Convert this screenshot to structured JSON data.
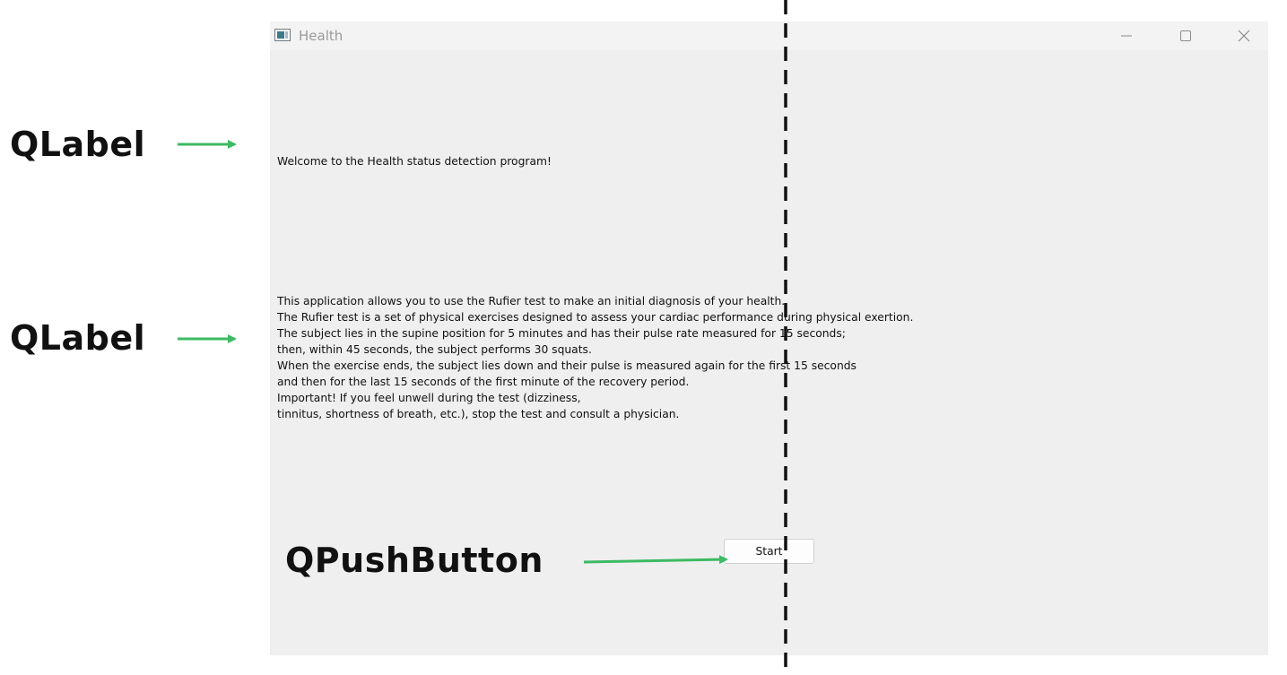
{
  "window": {
    "title": "Health",
    "buttons": {
      "minimize": "minimize-icon",
      "maximize": "maximize-icon",
      "close": "close-icon"
    }
  },
  "content": {
    "welcome_label": "Welcome to the Health status detection program!",
    "info_lines": [
      "This application allows you to use the Rufier test to make an initial diagnosis of your health.",
      "The Rufier test is a set of physical exercises designed to assess your cardiac performance during physical exertion.",
      "The subject lies in the supine position for 5 minutes and has their pulse rate measured for 15 seconds;",
      "then, within 45 seconds, the subject performs 30 squats.",
      "When the exercise ends, the subject lies down and their pulse is measured again for the first 15 seconds",
      "and then for the last 15 seconds of the first minute of the recovery period.",
      "Important! If you feel unwell during the test (dizziness,",
      "tinnitus, shortness of breath, etc.), stop the test and consult a physician."
    ],
    "start_button": "Start"
  },
  "annotations": {
    "label_1": "QLabel",
    "label_2": "QLabel",
    "button": "QPushButton",
    "arrow_color": "#3dba63",
    "divider_color": "#111111"
  }
}
